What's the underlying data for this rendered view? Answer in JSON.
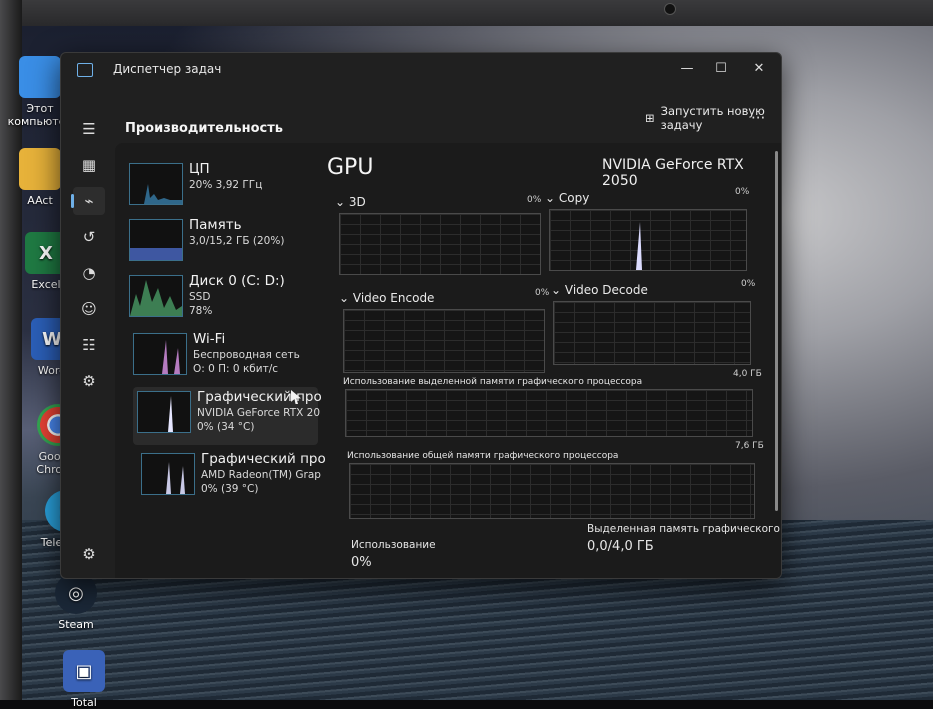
{
  "window": {
    "title": "Диспетчер задач",
    "controls": {
      "minimize": "—",
      "maximize": "☐",
      "close": "✕"
    }
  },
  "header": {
    "page_title": "Производительность",
    "run_task_label": "Запустить новую задачу",
    "more": "···"
  },
  "nav": [
    {
      "icon": "hamburger-icon",
      "glyph": "☰"
    },
    {
      "icon": "processes-icon",
      "glyph": "▦"
    },
    {
      "icon": "performance-icon",
      "glyph": "⌁",
      "active": true
    },
    {
      "icon": "app-history-icon",
      "glyph": "↺"
    },
    {
      "icon": "startup-icon",
      "glyph": "◔"
    },
    {
      "icon": "users-icon",
      "glyph": "☺"
    },
    {
      "icon": "details-icon",
      "glyph": "☷"
    },
    {
      "icon": "services-icon",
      "glyph": "⚙"
    },
    {
      "icon": "settings-icon",
      "glyph": "⚙"
    }
  ],
  "devices": [
    {
      "name": "ЦП",
      "sub1": "20%  3,92 ГГц",
      "sub2": "",
      "color": "#3c8bbd"
    },
    {
      "name": "Память",
      "sub1": "3,0/15,2 ГБ (20%)",
      "sub2": "",
      "color": "#4e6fd1"
    },
    {
      "name": "Диск 0 (C: D:)",
      "sub1": "SSD",
      "sub2": "78%",
      "color": "#4ca36a"
    },
    {
      "name": "Wi-Fi",
      "sub1": "Беспроводная сеть",
      "sub2": "О: 0 П: 0 кбит/с",
      "color": "#b57bc0"
    },
    {
      "name": "Графический про",
      "sub1": "NVIDIA GeForce RTX 20",
      "sub2": "0% (34 °C)",
      "color": "#7fa8d6"
    },
    {
      "name": "Графический про",
      "sub1": "AMD Radeon(TM) Grap",
      "sub2": "0% (39 °C)",
      "color": "#7fa8d6"
    }
  ],
  "gpu": {
    "title": "GPU",
    "model": "NVIDIA GeForce RTX 2050",
    "top_pct": "0%",
    "engines": [
      {
        "label": "3D",
        "pct": "0%"
      },
      {
        "label": "Copy",
        "pct": "0%"
      },
      {
        "label": "Video Encode",
        "pct": "0%"
      },
      {
        "label": "Video Decode",
        "pct": "0%"
      }
    ],
    "dedicated_max": "4,0 ГБ",
    "dedicated_label": "Использование выделенной памяти графического процессора",
    "shared_max": "7,6 ГБ",
    "shared_label": "Использование общей памяти графического процессора",
    "usage_label": "Использование",
    "usage_value": "0%",
    "dedicated_mem_label": "Выделенная память графического проц",
    "dedicated_mem_value": "0,0/4,0 ГБ"
  },
  "desktop_icons": [
    {
      "label": "Этот компьютер",
      "color": "#3a8ee6",
      "glyph": "▭"
    },
    {
      "label": "AAct",
      "color": "#e7b23a",
      "glyph": "▬"
    },
    {
      "label": "Excel",
      "color": "#1f7a43",
      "glyph": "X"
    },
    {
      "label": "Word",
      "color": "#2b5fb8",
      "glyph": "W"
    },
    {
      "label": "Google Chrome",
      "color": "#d9d9d9",
      "glyph": "◉"
    },
    {
      "label": "Telegram",
      "color": "#2aa3df",
      "glyph": "➤"
    },
    {
      "label": "Steam",
      "color": "#1b2838",
      "glyph": "◎"
    },
    {
      "label": "Total",
      "color": "#3a62b8",
      "glyph": "▣"
    }
  ]
}
